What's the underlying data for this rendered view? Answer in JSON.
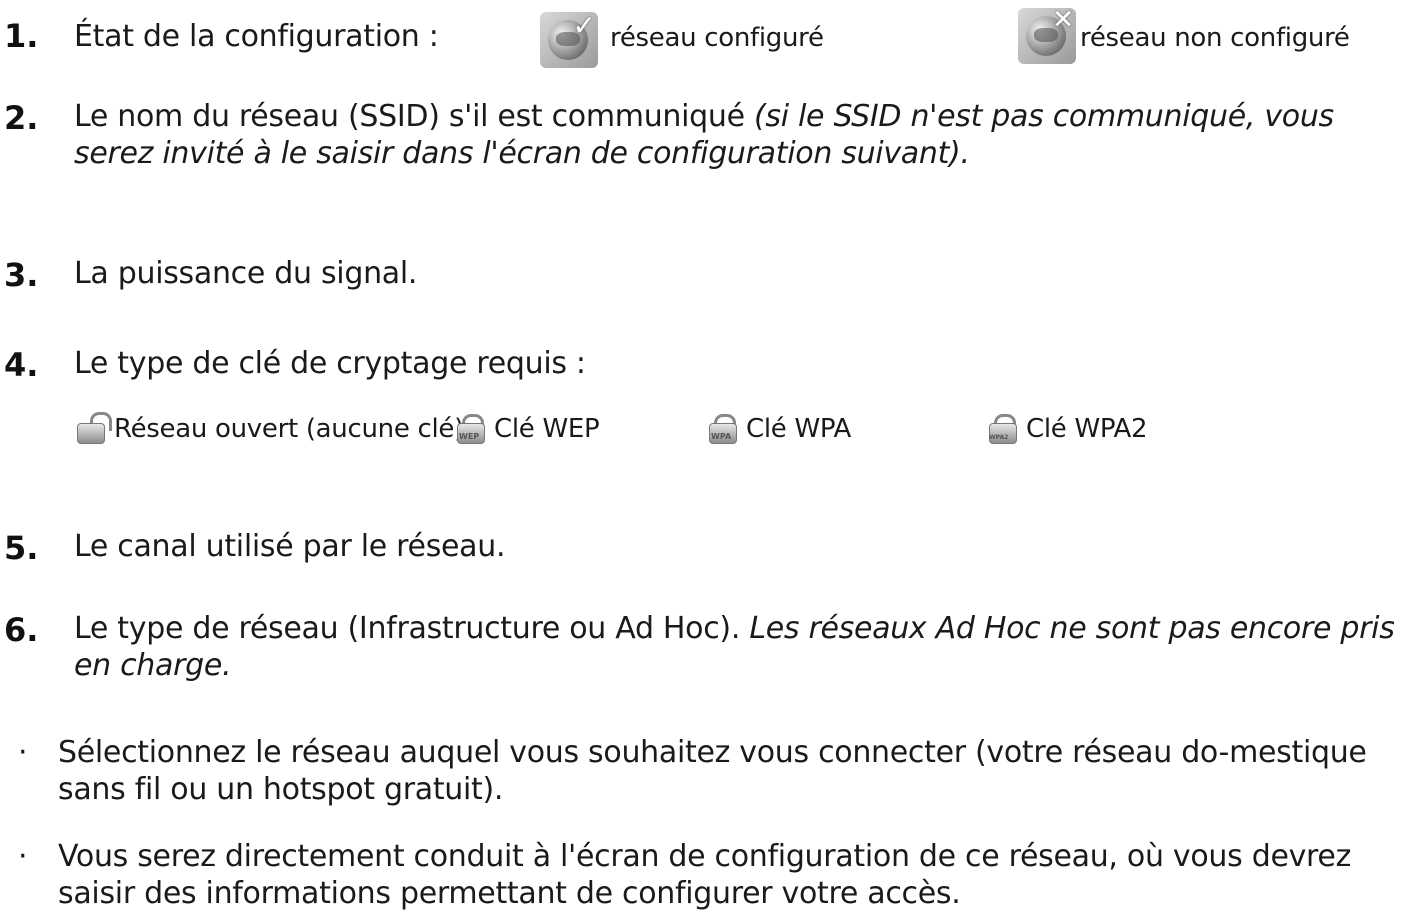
{
  "items": [
    {
      "number": "1.",
      "text": "État de la configuration :"
    },
    {
      "number": "2.",
      "text": "Le nom du réseau (SSID) s'il est communiqué ",
      "italic": "(si le SSID n'est pas communiqué, vous serez invité à le saisir dans l'écran de configuration suivant)."
    },
    {
      "number": "3.",
      "text": "La puissance du signal."
    },
    {
      "number": "4.",
      "text": "Le type de clé de cryptage requis :"
    },
    {
      "number": "5.",
      "text": "Le canal utilisé par le réseau."
    },
    {
      "number": "6.",
      "text": "Le type de réseau (Infrastructure ou Ad Hoc). ",
      "italic": "Les réseaux Ad Hoc ne sont pas encore pris en charge."
    }
  ],
  "config_states": [
    {
      "label": "réseau configuré",
      "icon": "network-configured-icon"
    },
    {
      "label": "réseau non configuré",
      "icon": "network-not-configured-icon"
    }
  ],
  "keys": [
    {
      "label": "Réseau ouvert (aucune clé)",
      "icon": "open-lock-icon"
    },
    {
      "label": "Clé WEP",
      "icon": "wep-lock-icon",
      "tag": "WEP"
    },
    {
      "label": "Clé WPA",
      "icon": "wpa-lock-icon",
      "tag": "WPA"
    },
    {
      "label": "Clé WPA2",
      "icon": "wpa2-lock-icon",
      "tag": "WPA2"
    }
  ],
  "bullets": [
    "Sélectionnez le réseau auquel vous souhaitez vous connecter (votre réseau do-mestique sans fil ou un hotspot gratuit).",
    "Vous serez directement conduit à l'écran de configuration de ce réseau, où vous devrez saisir des informations permettant de configurer votre accès."
  ]
}
